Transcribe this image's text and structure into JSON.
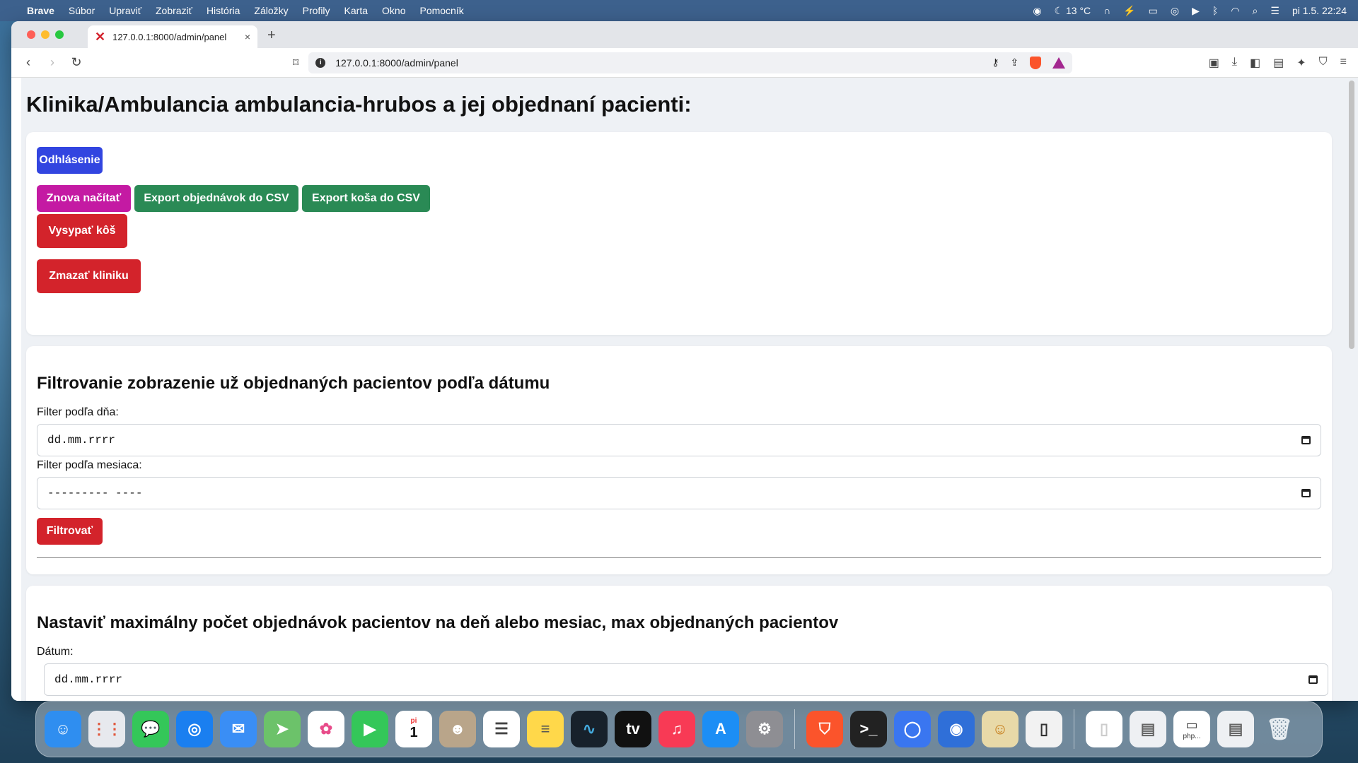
{
  "menubar": {
    "app_name": "Brave",
    "items": [
      "Súbor",
      "Upraviť",
      "Zobraziť",
      "História",
      "Záložky",
      "Profily",
      "Karta",
      "Okno",
      "Pomocník"
    ],
    "temperature": "13 °C",
    "datetime": "pi 1.5.  22:24"
  },
  "browser": {
    "tab_title": "127.0.0.1:8000/admin/panel",
    "tab_close": "×",
    "new_tab": "+",
    "url": "127.0.0.1:8000/admin/panel"
  },
  "page": {
    "title": "Klinika/Ambulancia ambulancia-hrubos a jej objednaní pacienti:",
    "actions": {
      "logout": "Odhlásenie",
      "reload": "Znova načítať",
      "export_orders": "Export objednávok do CSV",
      "export_bin": "Export koša do CSV",
      "empty_bin": "Vysypať kôš",
      "delete_clinic": "Zmazať kliniku"
    },
    "filter": {
      "heading": "Filtrovanie zobrazenie už objednaných pacientov podľa dátumu",
      "day_label": "Filter podľa dňa:",
      "day_value": "dd.mm.rrrr",
      "month_label": "Filter podľa mesiaca:",
      "month_value": "--------- ----",
      "submit": "Filtrovať"
    },
    "limit": {
      "heading": "Nastaviť maximálny počet objednávok pacientov na deň alebo mesiac, max objednaných pacientov",
      "date_label": "Dátum:",
      "date_value": "dd.mm.rrrr"
    }
  },
  "dock": {
    "calendar_day": "1",
    "calendar_weekday": "pi",
    "last_label": "php..."
  },
  "colors": {
    "logout": "#3245e0",
    "reload": "#c41aa3",
    "export": "#2a8a55",
    "danger": "#d3232b"
  }
}
